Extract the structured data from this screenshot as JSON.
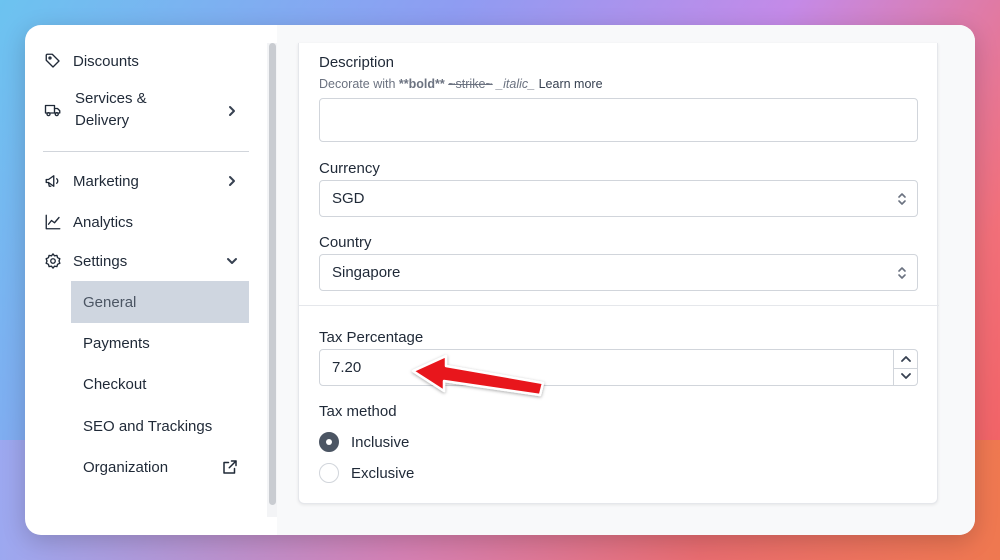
{
  "sidebar": {
    "items": [
      {
        "label": "Discounts",
        "icon": "tag-icon"
      },
      {
        "label": "Services &",
        "label2": "Delivery",
        "icon": "truck-icon"
      },
      {
        "label": "Marketing",
        "icon": "megaphone-icon"
      },
      {
        "label": "Analytics",
        "icon": "chart-line-icon"
      },
      {
        "label": "Settings",
        "icon": "gear-icon"
      }
    ],
    "settings_sub": [
      {
        "label": "General",
        "active": true
      },
      {
        "label": "Payments"
      },
      {
        "label": "Checkout"
      },
      {
        "label": "SEO and Trackings"
      },
      {
        "label": "Organization",
        "icon": "external-link-icon"
      }
    ]
  },
  "form": {
    "description": {
      "label": "Description",
      "help_prefix": "Decorate with ",
      "help_bold": "**bold**",
      "help_strike": "~strike~",
      "help_italic": "_italic_",
      "help_link": "Learn more",
      "value": ""
    },
    "currency": {
      "label": "Currency",
      "value": "SGD"
    },
    "country": {
      "label": "Country",
      "value": "Singapore"
    },
    "tax_percentage": {
      "label": "Tax Percentage",
      "value": "7.20"
    },
    "tax_method": {
      "label": "Tax method",
      "options": [
        {
          "label": "Inclusive",
          "checked": true
        },
        {
          "label": "Exclusive",
          "checked": false
        }
      ]
    }
  },
  "colors": {
    "accent_arrow": "#e8141a",
    "active_nav_bg": "#cfd6e0",
    "radio_checked": "#4b5563"
  }
}
